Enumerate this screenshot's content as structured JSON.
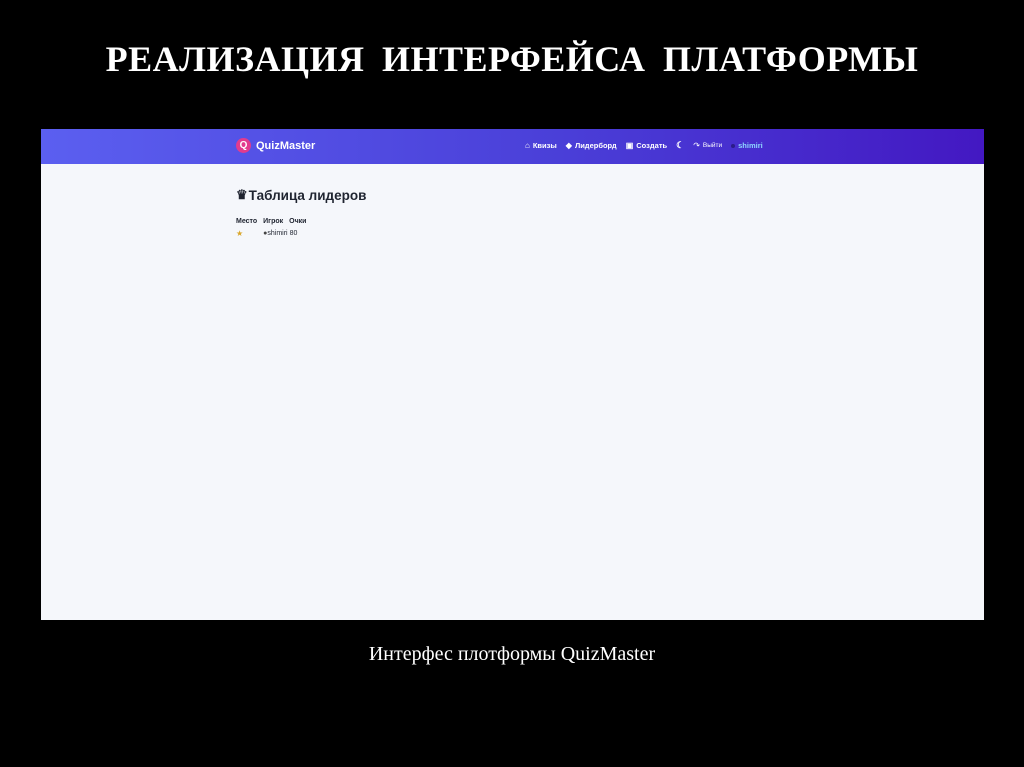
{
  "slide": {
    "title": "РЕАЛИЗАЦИЯ  ИНТЕРФЕЙСА ПЛАТФОРМЫ",
    "caption": "Интерфес плотформы QuizMaster"
  },
  "app": {
    "brand": {
      "logo_letter": "Q",
      "name": "QuizMaster"
    },
    "nav": {
      "quizzes": "Квизы",
      "leaderboard": "Лидерборд",
      "create": "Создать",
      "logout": "Выйти",
      "username": "shimiri"
    },
    "icons": {
      "quizzes": "home-icon",
      "leaderboard": "trophy-icon",
      "create": "plus-square-icon",
      "theme": "moon-icon",
      "logout": "logout-icon",
      "user": "user-icon",
      "heading": "crown-icon",
      "medal": "medal-icon"
    },
    "colors": {
      "nav_start": "#5b5ff0",
      "nav_end": "#4318c2",
      "logo": "#e23b8e",
      "username": "#8fd7ff",
      "background": "#f5f7fb"
    },
    "page": {
      "heading": "Таблица лидеров"
    },
    "leaderboard": {
      "columns": [
        "Место",
        "Игрок",
        "Очки"
      ],
      "rows": [
        {
          "player": "shimiri",
          "score": "80"
        }
      ]
    }
  }
}
